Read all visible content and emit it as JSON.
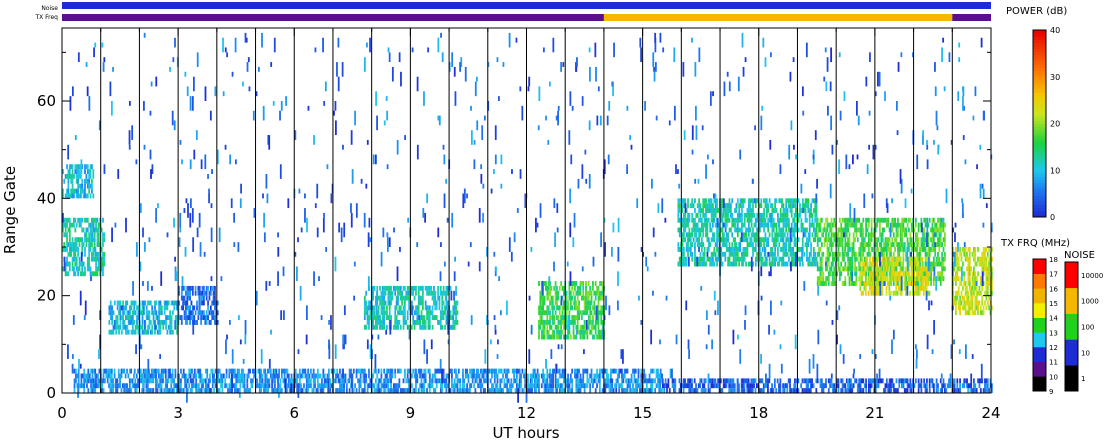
{
  "chart_data": {
    "type": "heatmap",
    "xlabel": "UT hours",
    "ylabel": "Range Gate",
    "xlim": [
      0,
      24
    ],
    "ylim": [
      0,
      75
    ],
    "x_ticks": [
      0,
      3,
      6,
      9,
      12,
      15,
      18,
      21,
      24
    ],
    "y_ticks": [
      0,
      20,
      40,
      60
    ],
    "scan_boundaries_hours": [
      1,
      2,
      3,
      4,
      5,
      6,
      7,
      8,
      9,
      10,
      11,
      12,
      13,
      14,
      15,
      16,
      17,
      18,
      19,
      20,
      21,
      22,
      23
    ],
    "top_strip_labels": [
      "Noise",
      "TX Freq"
    ],
    "tx_freq_strip": [
      {
        "from_hour": 0,
        "to_hour": 14,
        "color": "#5a0f8c"
      },
      {
        "from_hour": 14,
        "to_hour": 23,
        "color": "#f5b800"
      },
      {
        "from_hour": 23,
        "to_hour": 24,
        "color": "#5a0f8c"
      }
    ],
    "noise_strip_color": "#1e2cd6",
    "echo_regions": [
      {
        "t0": 0.0,
        "t1": 1.1,
        "g0": 24,
        "g1": 36,
        "power": 12
      },
      {
        "t0": 0.0,
        "t1": 0.8,
        "g0": 40,
        "g1": 47,
        "power": 10
      },
      {
        "t0": 1.2,
        "t1": 3.0,
        "g0": 12,
        "g1": 19,
        "power": 10
      },
      {
        "t0": 3.0,
        "t1": 4.0,
        "g0": 14,
        "g1": 22,
        "power": 5
      },
      {
        "t0": 7.8,
        "t1": 10.2,
        "g0": 13,
        "g1": 22,
        "power": 11
      },
      {
        "t0": 12.3,
        "t1": 14.0,
        "g0": 11,
        "g1": 23,
        "power": 16
      },
      {
        "t0": 15.9,
        "t1": 19.5,
        "g0": 26,
        "g1": 40,
        "power": 12
      },
      {
        "t0": 19.5,
        "t1": 22.8,
        "g0": 22,
        "g1": 36,
        "power": 17
      },
      {
        "t0": 20.6,
        "t1": 22.4,
        "g0": 20,
        "g1": 28,
        "power": 23
      },
      {
        "t0": 23.0,
        "t1": 24.0,
        "g0": 16,
        "g1": 30,
        "power": 22
      },
      {
        "t0": 0.3,
        "t1": 15.5,
        "g0": 0,
        "g1": 5,
        "power": 7
      },
      {
        "t0": 15.5,
        "t1": 24.0,
        "g0": 0,
        "g1": 3,
        "power": 4
      }
    ],
    "power_colorbar": {
      "title": "POWER (dB)",
      "ticks": [
        0,
        10,
        20,
        30,
        40
      ],
      "range": [
        0,
        40
      ]
    },
    "txfreq_colorbar": {
      "title": "TX FRQ (MHz)",
      "ticks": [
        9,
        10,
        11,
        12,
        13,
        14,
        15,
        16,
        17,
        18
      ],
      "colors": [
        "#000000",
        "#5a0f8c",
        "#1e2cd6",
        "#1ec8f0",
        "#1ed21e",
        "#f0f000",
        "#f0b400",
        "#ff7800",
        "#ff0000"
      ]
    },
    "noise_colorbar": {
      "title": "NOISE",
      "ticks": [
        "1",
        "10",
        "100",
        "1000",
        "10000"
      ],
      "colors": [
        "#000000",
        "#1e2cd6",
        "#1ed21e",
        "#f5b800",
        "#ff0000"
      ]
    }
  }
}
